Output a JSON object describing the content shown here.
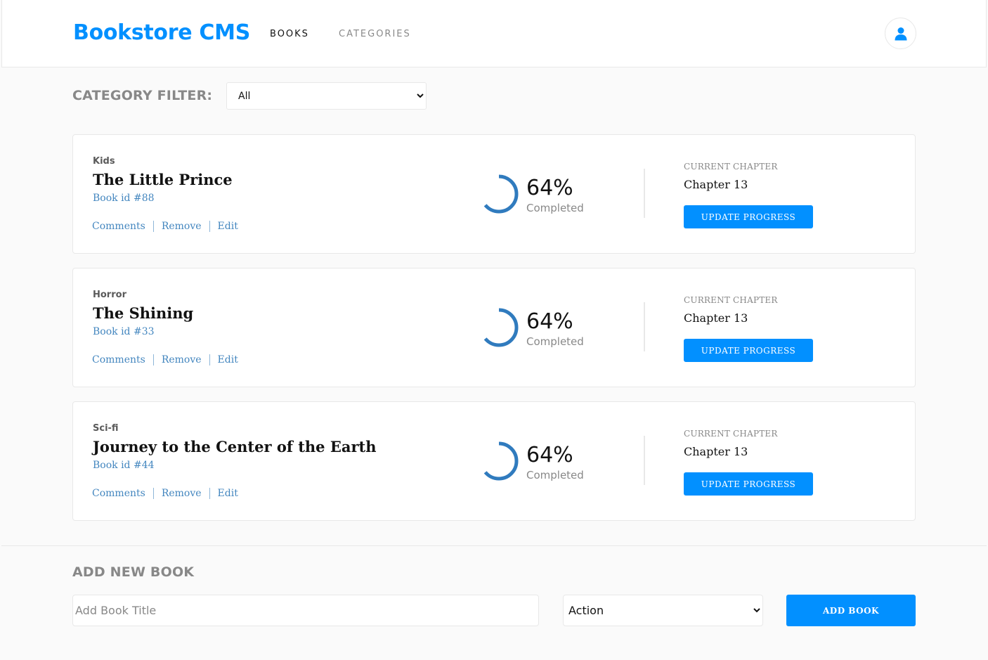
{
  "header": {
    "logo": "Bookstore CMS",
    "nav": [
      {
        "label": "BOOKS"
      },
      {
        "label": "CATEGORIES"
      }
    ],
    "user_icon": "user-icon"
  },
  "filter": {
    "label": "CATEGORY FILTER:",
    "selected": "All",
    "options": [
      "All"
    ]
  },
  "books": [
    {
      "category": "Kids",
      "title": "The Little Prince",
      "book_id": "Book id #88",
      "actions": [
        "Comments",
        "Remove",
        "Edit"
      ],
      "progress_percent": 64,
      "percent_label": "64%",
      "completed_label": "Completed",
      "chapter_label": "CURRENT CHAPTER",
      "chapter": "Chapter 13",
      "update_label": "UPDATE PROGRESS"
    },
    {
      "category": "Horror",
      "title": "The Shining",
      "book_id": "Book id #33",
      "actions": [
        "Comments",
        "Remove",
        "Edit"
      ],
      "progress_percent": 64,
      "percent_label": "64%",
      "completed_label": "Completed",
      "chapter_label": "CURRENT CHAPTER",
      "chapter": "Chapter 13",
      "update_label": "UPDATE PROGRESS"
    },
    {
      "category": "Sci-fi",
      "title": "Journey to the Center of the Earth",
      "book_id": "Book id #44",
      "actions": [
        "Comments",
        "Remove",
        "Edit"
      ],
      "progress_percent": 64,
      "percent_label": "64%",
      "completed_label": "Completed",
      "chapter_label": "CURRENT CHAPTER",
      "chapter": "Chapter 13",
      "update_label": "UPDATE PROGRESS"
    }
  ],
  "add_form": {
    "title": "ADD NEW BOOK",
    "title_placeholder": "Add Book Title",
    "title_value": "",
    "category_selected": "Action",
    "category_options": [
      "Action"
    ],
    "submit_label": "ADD BOOK"
  },
  "colors": {
    "accent": "#0290ff",
    "link": "#4386bf",
    "ring": "#307bbe",
    "muted": "#888888"
  }
}
